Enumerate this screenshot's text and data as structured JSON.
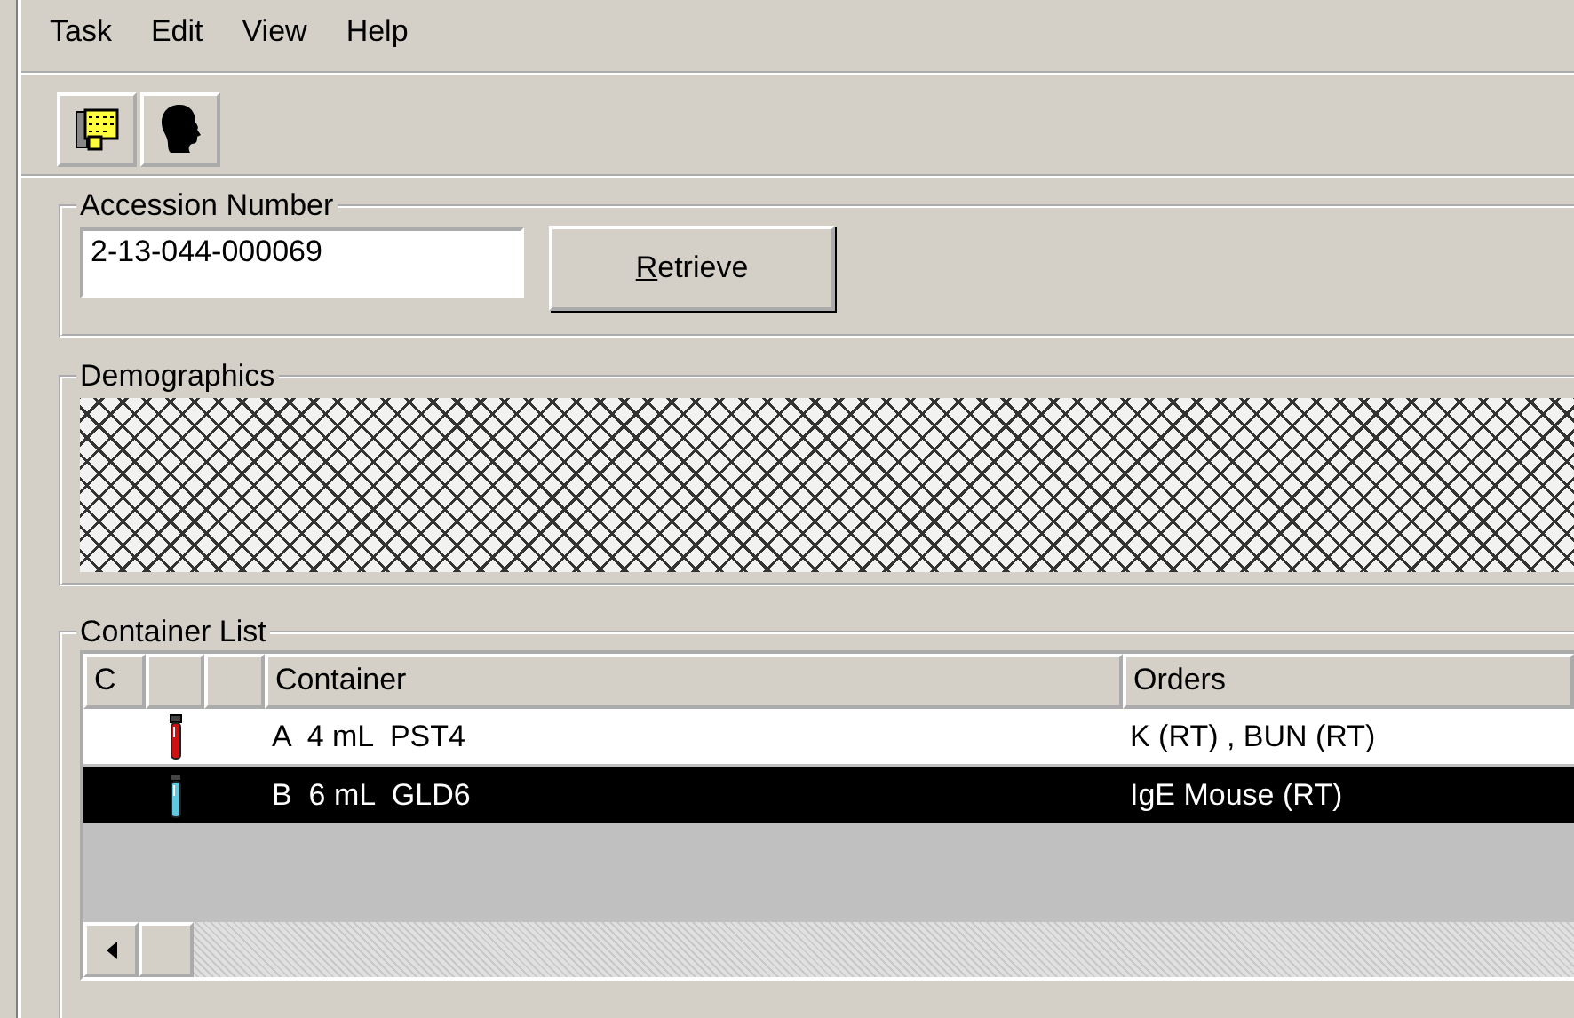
{
  "menu": [
    "Task",
    "Edit",
    "View",
    "Help"
  ],
  "accession": {
    "title": "Accession Number",
    "value": "2-13-044-000069",
    "button": "Retrieve"
  },
  "demographics": {
    "title": "Demographics",
    "redacted": true
  },
  "container_list": {
    "title": "Container List",
    "columns": [
      "C",
      "",
      "",
      "Container",
      "Orders"
    ],
    "rows": [
      {
        "container": "A  4 mL  PST4",
        "orders": "K (RT) , BUN (RT)",
        "color": "#d01010",
        "selected": false
      },
      {
        "container": "B  6 mL  GLD6",
        "orders": "IgE Mouse (RT)",
        "color": "#60c8e0",
        "selected": true
      }
    ]
  }
}
